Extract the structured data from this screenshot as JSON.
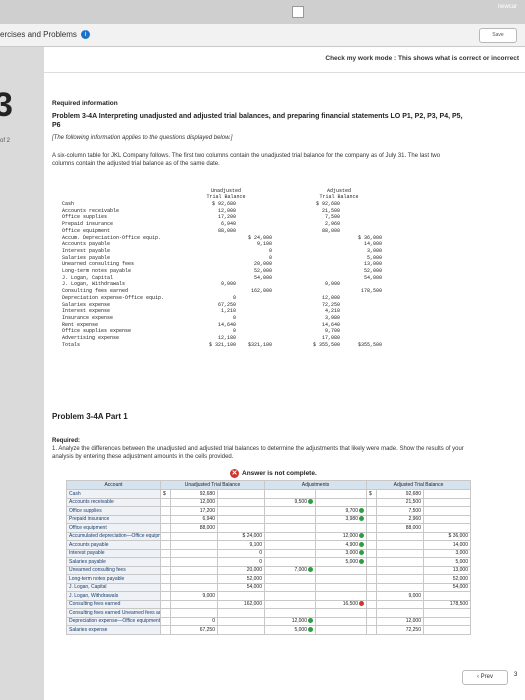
{
  "header": {
    "page_title": "ercises and Problems",
    "save_label": "Save",
    "corner_text": "newcar"
  },
  "left_rail": {
    "number": "3",
    "part": "of 2"
  },
  "check_bar": {
    "text": "Check my work mode : This shows what is correct or incorrect"
  },
  "problem": {
    "required_info": "Required information",
    "title": "Problem 3-4A Interpreting unadjusted and adjusted trial balances, and preparing financial statements LO P1, P2, P3, P4, P5, P6",
    "applies": "[The following information applies to the questions displayed below.]",
    "intro": "A six-column table for JKL Company follows. The first two columns contain the unadjusted trial balance for the company as of July 31. The last two columns contain the adjusted trial balance as of the same date."
  },
  "trial_table": {
    "unadj_header": "Unadjusted\nTrial Balance",
    "adj_header": "Adjusted\nTrial Balance",
    "accounts": "Cash\nAccounts receivable\nOffice supplies\nPrepaid insurance\nOffice equipment\nAccum. Depreciation-Office equip.\nAccounts payable\nInterest payable\nSalaries payable\nUnearned consulting fees\nLong-term notes payable\nJ. Logan, Capital\nJ. Logan, Withdrawals\nConsulting fees earned\nDepreciation expense-Office equip.\nSalaries expense\nInterest expense\nInsurance expense\nRent expense\nOffice supplies expense\nAdvertising expense\nTotals",
    "unadj_dr": "$ 92,680\n12,000\n17,200\n6,940\n88,000\n\n\n\n\n\n\n\n9,000\n\n0\n67,250\n1,210\n0\n14,640\n0\n12,180\n$ 321,100",
    "unadj_cr": "\n\n\n\n\n$ 24,000\n9,100\n0\n0\n20,000\n52,000\n54,000\n\n162,000\n\n\n\n\n\n\n\n$321,100",
    "adj_dr": "$ 92,680\n21,500\n7,500\n2,960\n88,000\n\n\n\n\n\n\n\n9,000\n\n12,000\n72,250\n4,210\n3,980\n14,640\n9,700\n17,080\n$ 355,500",
    "adj_cr": "\n\n\n\n\n$ 36,000\n14,000\n3,000\n5,000\n13,000\n52,000\n54,000\n\n178,500\n\n\n\n\n\n\n\n$355,500"
  },
  "part1": {
    "heading": "Problem 3-4A Part 1",
    "required": "Required:",
    "instruction": "1. Analyze the differences between the unadjusted and adjusted trial balances to determine the adjustments that likely were made. Show the results of your analysis by entering these adjustment amounts in the cells provided.",
    "answer_status": "Answer is not complete."
  },
  "grid": {
    "col_account": "Account",
    "col_unadj": "Unadjusted Trial Balance",
    "col_adjustments": "Adjustments",
    "col_adj": "Adjusted Trial Balance",
    "rows": [
      {
        "acct": "Cash",
        "udol": "$",
        "udr": "92,680",
        "ucr": "",
        "adr": "",
        "acr": "",
        "adol": "$",
        "tdr": "92,680",
        "tcr": ""
      },
      {
        "acct": "Accounts receivable",
        "udol": "",
        "udr": "12,000",
        "ucr": "",
        "adr": "9,500",
        "acr": "",
        "adol": "",
        "tdr": "21,500",
        "tcr": ""
      },
      {
        "acct": "Office supplies",
        "udol": "",
        "udr": "17,200",
        "ucr": "",
        "adr": "",
        "acr": "9,700",
        "adol": "",
        "tdr": "7,500",
        "tcr": ""
      },
      {
        "acct": "Prepaid insurance",
        "udol": "",
        "udr": "6,940",
        "ucr": "",
        "adr": "",
        "acr": "3,980",
        "adol": "",
        "tdr": "2,960",
        "tcr": ""
      },
      {
        "acct": "Office equipment",
        "udol": "",
        "udr": "88,000",
        "ucr": "",
        "adr": "",
        "acr": "",
        "adol": "",
        "tdr": "88,000",
        "tcr": ""
      },
      {
        "acct": "Accumulated depreciation—Office equipment",
        "udol": "",
        "udr": "",
        "ucr": "$ 24,000",
        "adr": "",
        "acr": "12,000",
        "adol": "",
        "tdr": "",
        "tcr": "$ 36,000"
      },
      {
        "acct": "Accounts payable",
        "udol": "",
        "udr": "",
        "ucr": "9,100",
        "adr": "",
        "acr": "4,900",
        "adol": "",
        "tdr": "",
        "tcr": "14,000"
      },
      {
        "acct": "Interest payable",
        "udol": "",
        "udr": "",
        "ucr": "0",
        "adr": "",
        "acr": "3,000",
        "adol": "",
        "tdr": "",
        "tcr": "3,000"
      },
      {
        "acct": "Salaries payable",
        "udol": "",
        "udr": "",
        "ucr": "0",
        "adr": "",
        "acr": "5,000",
        "adol": "",
        "tdr": "",
        "tcr": "5,000"
      },
      {
        "acct": "Unearned consulting fees",
        "udol": "",
        "udr": "",
        "ucr": "20,000",
        "adr": "7,000",
        "acr": "",
        "adol": "",
        "tdr": "",
        "tcr": "13,000"
      },
      {
        "acct": "Long-term notes payable",
        "udol": "",
        "udr": "",
        "ucr": "52,000",
        "adr": "",
        "acr": "",
        "adol": "",
        "tdr": "",
        "tcr": "52,000"
      },
      {
        "acct": "J. Logan, Capital",
        "udol": "",
        "udr": "",
        "ucr": "54,000",
        "adr": "",
        "acr": "",
        "adol": "",
        "tdr": "",
        "tcr": "54,000"
      },
      {
        "acct": "J. Logan, Withdrawals",
        "udol": "",
        "udr": "9,000",
        "ucr": "",
        "adr": "",
        "acr": "",
        "adol": "",
        "tdr": "9,000",
        "tcr": ""
      },
      {
        "acct": "Consulting fees earned",
        "udol": "",
        "udr": "",
        "ucr": "162,000",
        "adr": "",
        "acr": "16,500",
        "adol": "",
        "tdr": "",
        "tcr": "178,500"
      },
      {
        "acct": "Consulting fees earned Unearned fees adjusted",
        "udol": "",
        "udr": "",
        "ucr": "",
        "adr": "",
        "acr": "",
        "adol": "",
        "tdr": "",
        "tcr": ""
      },
      {
        "acct": "Depreciation expense—Office equipment",
        "udol": "",
        "udr": "0",
        "ucr": "",
        "adr": "12,000",
        "acr": "",
        "adol": "",
        "tdr": "12,000",
        "tcr": ""
      },
      {
        "acct": "Salaries expense",
        "udol": "",
        "udr": "67,250",
        "ucr": "",
        "adr": "5,000",
        "acr": "",
        "adol": "",
        "tdr": "72,250",
        "tcr": ""
      }
    ],
    "status": {
      "r1_adr": "ok",
      "r2_acr": "ok",
      "r3_acr": "ok",
      "r5_acr": "ok",
      "r6_acr": "ok",
      "r7_acr": "ok",
      "r8_acr": "ok",
      "r9_adr": "ok",
      "r13_acr": "bad",
      "r15_adr": "ok",
      "r16_adr": "ok"
    }
  },
  "nav": {
    "prev_label": "Prev",
    "page": "3"
  }
}
